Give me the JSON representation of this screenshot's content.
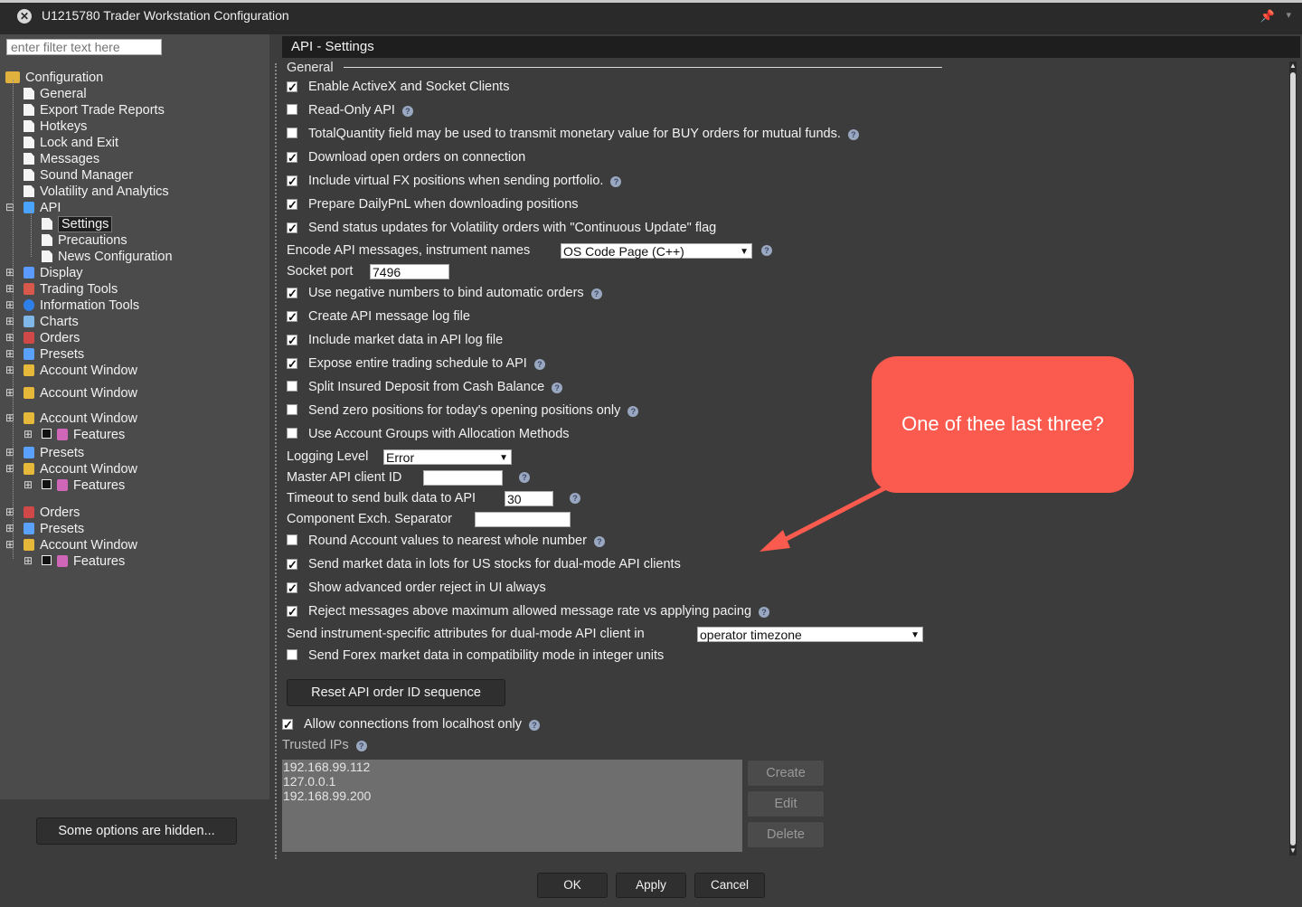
{
  "window": {
    "title": "U1215780 Trader Workstation Configuration",
    "close_glyph": "✕",
    "pin_glyph": "📌",
    "menu_glyph": "▾"
  },
  "sidebar": {
    "filter_placeholder": "enter filter text here",
    "tree": [
      {
        "label": "Configuration",
        "icon": "folder-icon"
      },
      {
        "label": "General",
        "icon": "document-icon"
      },
      {
        "label": "Export Trade Reports",
        "icon": "document-icon"
      },
      {
        "label": "Hotkeys",
        "icon": "document-icon"
      },
      {
        "label": "Lock and Exit",
        "icon": "document-icon"
      },
      {
        "label": "Messages",
        "icon": "document-icon"
      },
      {
        "label": "Sound Manager",
        "icon": "document-icon"
      },
      {
        "label": "Volatility and Analytics",
        "icon": "document-icon"
      },
      {
        "label": "API",
        "icon": "api-icon"
      },
      {
        "label": "Settings",
        "icon": "document-icon"
      },
      {
        "label": "Precautions",
        "icon": "document-icon"
      },
      {
        "label": "News Configuration",
        "icon": "document-icon"
      },
      {
        "label": "Display",
        "icon": "display-icon"
      },
      {
        "label": "Trading Tools",
        "icon": "trading-tools-icon"
      },
      {
        "label": "Information Tools",
        "icon": "info-icon"
      },
      {
        "label": "Charts",
        "icon": "chart-icon"
      },
      {
        "label": "Orders",
        "icon": "orders-icon"
      },
      {
        "label": "Presets",
        "icon": "presets-icon"
      },
      {
        "label": "Account Window",
        "icon": "account-icon"
      },
      {
        "label": "Account Window",
        "icon": "account-icon"
      },
      {
        "label": "Account Window",
        "icon": "account-icon"
      },
      {
        "label": "Features",
        "icon": "features-icon"
      },
      {
        "label": "Presets",
        "icon": "presets-icon"
      },
      {
        "label": "Account Window",
        "icon": "account-icon"
      },
      {
        "label": "Features",
        "icon": "features-icon"
      },
      {
        "label": "Orders",
        "icon": "orders-icon"
      },
      {
        "label": "Presets",
        "icon": "presets-icon"
      },
      {
        "label": "Account Window",
        "icon": "account-icon"
      },
      {
        "label": "Features",
        "icon": "features-icon"
      }
    ],
    "hidden_button": "Some options are hidden..."
  },
  "panel": {
    "title": "API - Settings",
    "section_general": "General",
    "options": [
      {
        "label": "Enable ActiveX and Socket Clients",
        "checked": true,
        "help": false
      },
      {
        "label": "Read-Only API",
        "checked": false,
        "help": true
      },
      {
        "label": "TotalQuantity field may be used to transmit monetary value for BUY orders for mutual funds.",
        "checked": false,
        "help": true
      },
      {
        "label": "Download open orders on connection",
        "checked": true,
        "help": false
      },
      {
        "label": "Include virtual FX positions when sending portfolio.",
        "checked": true,
        "help": true
      },
      {
        "label": "Prepare DailyPnL when downloading positions",
        "checked": true,
        "help": false
      },
      {
        "label": "Send status updates for Volatility orders with \"Continuous Update\" flag",
        "checked": true,
        "help": false
      }
    ],
    "encode_label": "Encode API messages, instrument names",
    "encode_value": "OS Code Page (C++)",
    "socket_label": "Socket port",
    "socket_value": "7496",
    "options2": [
      {
        "label": "Use negative numbers to bind automatic orders",
        "checked": true,
        "help": true
      },
      {
        "label": "Create API message log file",
        "checked": true,
        "help": false
      },
      {
        "label": "Include market data in API log file",
        "checked": true,
        "help": false
      },
      {
        "label": "Expose entire trading schedule to API",
        "checked": true,
        "help": true
      },
      {
        "label": "Split Insured Deposit from Cash Balance",
        "checked": false,
        "help": true
      },
      {
        "label": "Send zero positions for today's opening positions only",
        "checked": false,
        "help": true
      },
      {
        "label": "Use Account Groups with Allocation Methods",
        "checked": false,
        "help": false
      }
    ],
    "logging_label": "Logging Level",
    "logging_value": "Error",
    "master_label": "Master API client ID",
    "master_value": "",
    "timeout_label": "Timeout to send bulk data to API",
    "timeout_value": "30",
    "separator_label": "Component Exch. Separator",
    "separator_value": "",
    "options3": [
      {
        "label": "Round Account values to nearest whole number",
        "checked": false,
        "help": true
      },
      {
        "label": "Send market data in lots for US stocks for dual-mode API clients",
        "checked": true,
        "help": false
      },
      {
        "label": "Show advanced order reject in UI always",
        "checked": true,
        "help": false
      },
      {
        "label": "Reject messages above maximum allowed message rate vs applying pacing",
        "checked": true,
        "help": true
      }
    ],
    "attributes_label": "Send instrument-specific attributes for dual-mode API client in",
    "attributes_value": "operator timezone",
    "forex_label": "Send Forex market data in compatibility mode in integer units",
    "forex_checked": false,
    "reset_button": "Reset API order ID sequence",
    "localhost_label": "Allow connections from localhost only",
    "localhost_checked": true,
    "trusted_label": "Trusted IPs",
    "trusted_ips": [
      "192.168.99.112",
      "127.0.0.1",
      "192.168.99.200"
    ],
    "create_button": "Create",
    "edit_button": "Edit",
    "delete_button": "Delete",
    "check_glyph": "✓",
    "help_glyph": "?",
    "dropdown_glyph": "▼"
  },
  "footer": {
    "ok": "OK",
    "apply": "Apply",
    "cancel": "Cancel"
  },
  "annotation": {
    "text": "One of thee last three?",
    "color": "#fb5a4e"
  },
  "colors": {
    "background": "#3c3c3c",
    "sidebar": "#4b4b4b",
    "header": "#1e1e1e"
  }
}
